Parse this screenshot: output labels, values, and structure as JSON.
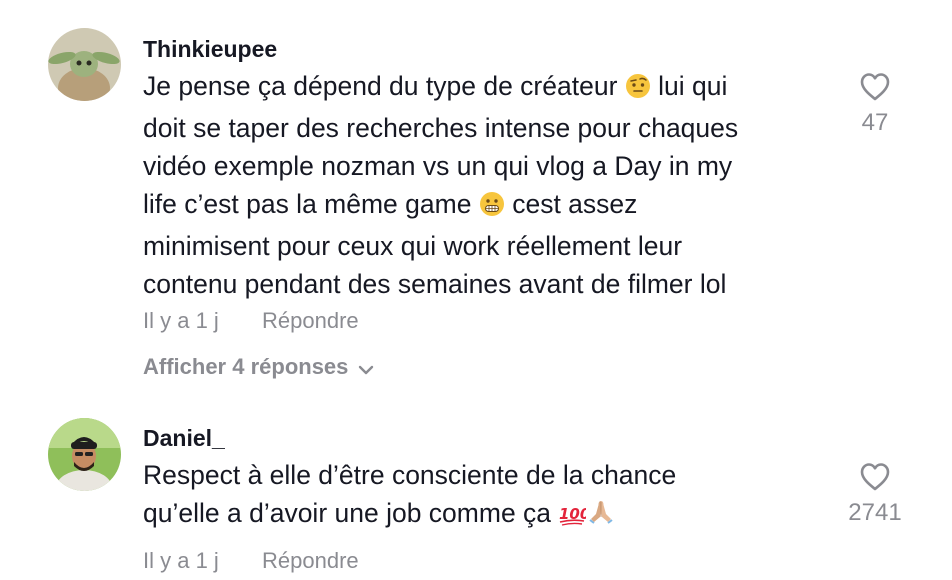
{
  "comments": [
    {
      "username": "Thinkieupee",
      "text_1": "Je pense ça dépend du type de créateur",
      "text_2": "lui qui\ndoit se taper des recherches intense pour chaques\nvidéo exemple nozman vs un qui vlog a Day in my\nlife c’est pas la même game",
      "text_3": "cest assez\nminimisent pour ceux qui work réellement leur\ncontenu pendant des semaines avant de filmer lol",
      "emoji_1": "raised-eyebrow-face-emoji",
      "emoji_2": "grimacing-face-emoji",
      "time": "Il y a 1 j",
      "reply_label": "Répondre",
      "like_icon": "heart-outline-icon",
      "like_count": "47",
      "show_replies_label": "Afficher 4 réponses",
      "show_replies_icon": "chevron-down-icon"
    },
    {
      "username": "Daniel_",
      "text_1": "Respect à elle d’être consciente de la chance\nqu’elle a d’avoir une job comme ça",
      "emoji_1": "hundred-points-emoji",
      "emoji_2": "folded-hands-emoji",
      "time": "Il y a 1 j",
      "reply_label": "Répondre",
      "like_icon": "heart-outline-icon",
      "like_count": "2741"
    }
  ],
  "colors": {
    "primary_text": "#161823",
    "secondary_text": "#8a8b91",
    "background": "#ffffff"
  }
}
